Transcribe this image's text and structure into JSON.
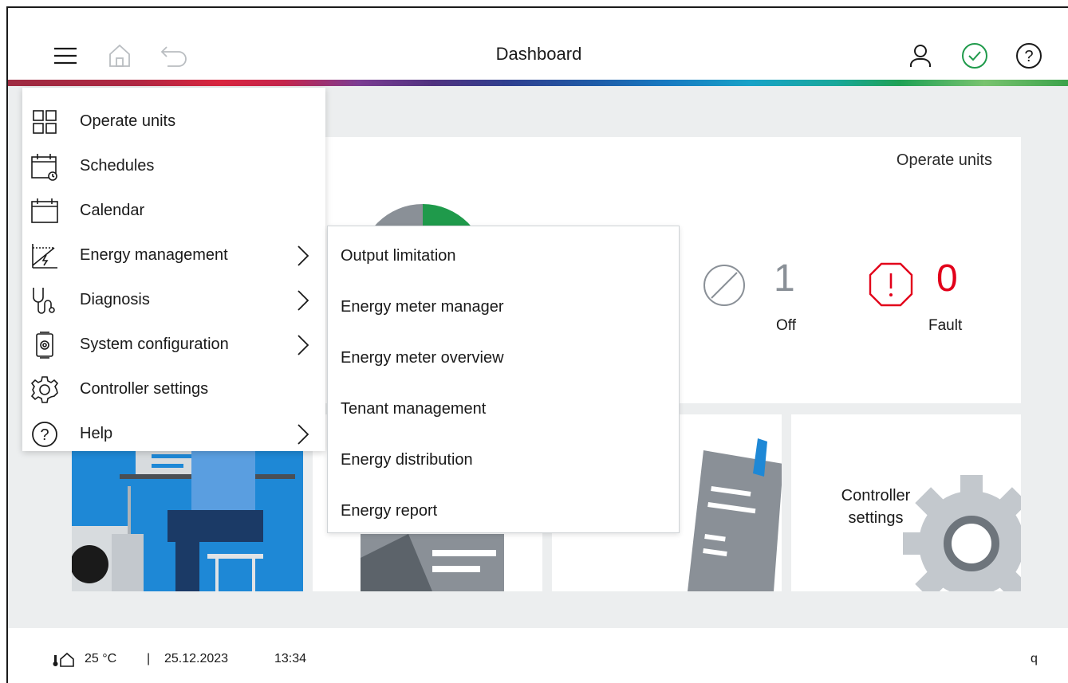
{
  "header": {
    "title": "Dashboard",
    "icons": [
      "hamburger-menu-icon",
      "home-icon",
      "back-icon",
      "user-icon",
      "status-ok-icon",
      "help-icon"
    ]
  },
  "operate_units_card": {
    "title": "Operate units",
    "gauge": {
      "gray_fraction": 0.5,
      "green_fraction": 0.5,
      "colors": {
        "gray": "#8a9097",
        "green": "#1f9a4b"
      }
    },
    "off": {
      "value": "1",
      "label": "Off",
      "icon": "off-icon"
    },
    "fault": {
      "value": "0",
      "label": "Fault",
      "icon": "fault-octagon-icon",
      "color": "#e2001a"
    }
  },
  "tiles": {
    "controller_settings": "Controller settings"
  },
  "main_menu": {
    "items": [
      {
        "label": "Operate units",
        "icon": "operate-units-icon",
        "has_submenu": false
      },
      {
        "label": "Schedules",
        "icon": "schedules-icon",
        "has_submenu": false
      },
      {
        "label": "Calendar",
        "icon": "calendar-icon",
        "has_submenu": false
      },
      {
        "label": "Energy management",
        "icon": "energy-management-icon",
        "has_submenu": true
      },
      {
        "label": "Diagnosis",
        "icon": "diagnosis-icon",
        "has_submenu": true
      },
      {
        "label": "System configuration",
        "icon": "system-configuration-icon",
        "has_submenu": true
      },
      {
        "label": "Controller settings",
        "icon": "gear-icon",
        "has_submenu": false
      },
      {
        "label": "Help",
        "icon": "help-icon",
        "has_submenu": true
      }
    ]
  },
  "energy_submenu": {
    "items": [
      {
        "label": "Output limitation"
      },
      {
        "label": "Energy meter manager"
      },
      {
        "label": "Energy meter overview"
      },
      {
        "label": "Tenant management"
      },
      {
        "label": "Energy distribution"
      },
      {
        "label": "Energy report"
      }
    ]
  },
  "footer": {
    "temperature": "25 °C",
    "separator": "|",
    "date": "25.12.2023",
    "time": "13:34",
    "right_text": "q"
  },
  "colors": {
    "accent_red": "#e2001a",
    "status_green": "#1f9a4b",
    "content_bg": "#eceeef"
  }
}
